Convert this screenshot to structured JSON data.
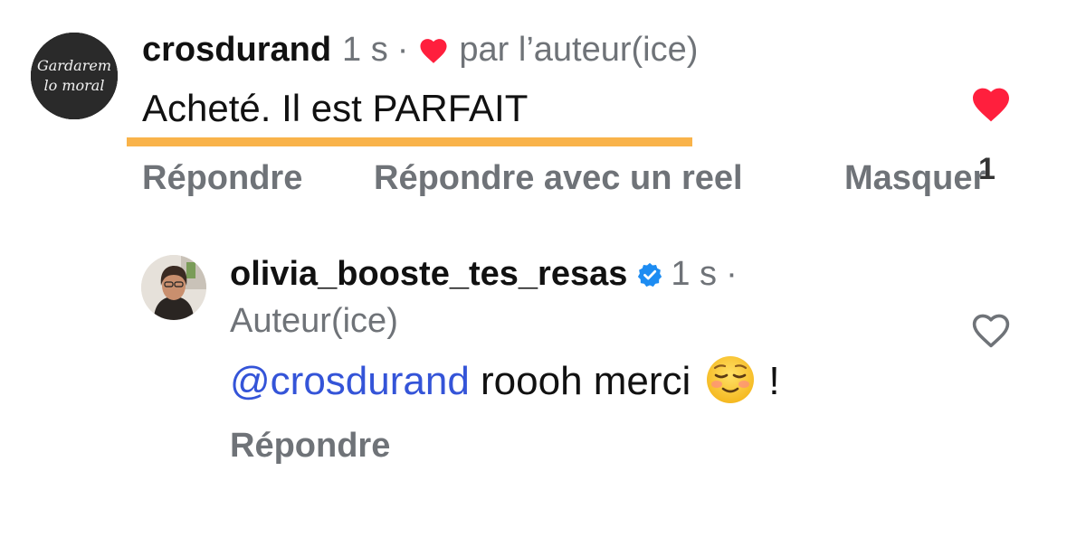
{
  "comment": {
    "avatar_text": [
      "Gardarem",
      "lo moral"
    ],
    "username": "crosdurand",
    "time": "1 s",
    "separator": "·",
    "liked_by_author_label": "par l’auteur(ice)",
    "text": "Acheté. Il est PARFAIT",
    "actions": {
      "reply": "Répondre",
      "reply_reel": "Répondre avec un reel",
      "hide": "Masquer"
    },
    "like_count": "1",
    "liked": true
  },
  "reply": {
    "username": "olivia_booste_tes_resas",
    "verified": true,
    "time": "1 s",
    "separator": "·",
    "role": "Auteur(ice)",
    "mention": "@crosdurand",
    "text_before_emoji": " roooh merci",
    "emoji": "smiling-face-emoji",
    "text_after_emoji": "!",
    "actions": {
      "reply": "Répondre"
    },
    "liked": false
  },
  "colors": {
    "like_red": "#ff1f3d",
    "muted_text": "#6f7378",
    "mention_blue": "#3454d8",
    "highlight": "#f9b34a",
    "verified_blue": "#1d8cf2"
  }
}
